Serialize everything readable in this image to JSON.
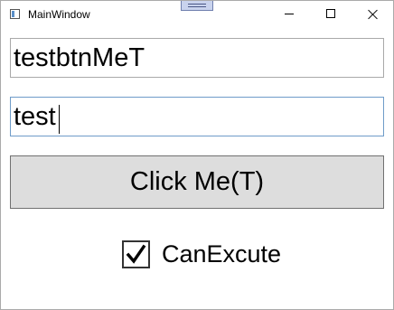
{
  "window": {
    "title": "MainWindow"
  },
  "caption_buttons": {
    "minimize": "minimize-icon",
    "maximize": "maximize-icon",
    "close": "close-icon"
  },
  "form": {
    "textbox1_value": "testbtnMeT",
    "textbox2_value": "test",
    "button_label": "Click Me(T)",
    "checkbox_label": "CanExcute",
    "checkbox_checked": true
  }
}
